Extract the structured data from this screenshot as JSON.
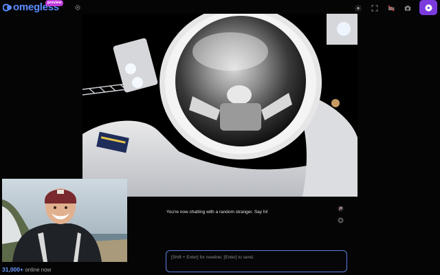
{
  "header": {
    "logo_text": "omegless",
    "logo_badge": "preview",
    "colors": {
      "brand": "#5a8cff",
      "badge": "#c03ad9",
      "next": "#7b3bdc",
      "input_border": "#5a7fe0"
    },
    "icons": [
      "settings-icon",
      "brightness-icon",
      "fullscreen-icon",
      "camera-off-icon",
      "screenshot-icon",
      "next-stranger-icon"
    ]
  },
  "stranger_video": {
    "content": "astronaut-helmet-image"
  },
  "self_video": {
    "content": "smiling-man-beanie-image"
  },
  "status": {
    "online_count": "31,000+",
    "online_label": " online now"
  },
  "chat": {
    "status_message": "You're now chatting with a random stranger. Say hi!",
    "input_placeholder": "[Shift + Enter] for newline; [Enter] to send."
  }
}
